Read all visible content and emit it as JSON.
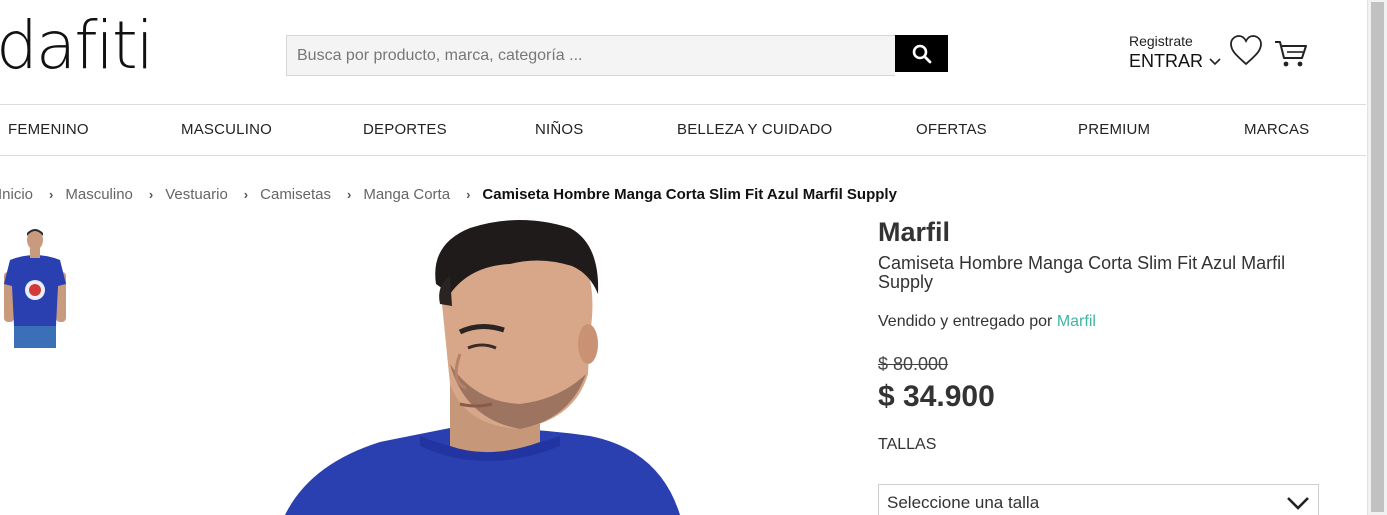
{
  "header": {
    "logo": "dafiti",
    "search_placeholder": "Busca por producto, marca, categoría ...",
    "register_label": "Registrate",
    "login_label": "ENTRAR"
  },
  "nav": {
    "items": [
      "FEMENINO",
      "MASCULINO",
      "DEPORTES",
      "NIÑOS",
      "BELLEZA Y CUIDADO",
      "OFERTAS",
      "PREMIUM",
      "MARCAS"
    ]
  },
  "breadcrumb": {
    "items": [
      "Inicio",
      "Masculino",
      "Vestuario",
      "Camisetas",
      "Manga Corta"
    ],
    "current": "Camiseta Hombre Manga Corta Slim Fit Azul Marfil Supply"
  },
  "product": {
    "brand": "Marfil",
    "name": "Camiseta Hombre Manga Corta Slim Fit Azul Marfil Supply",
    "seller_prefix": "Vendido y entregado por",
    "seller_name": "Marfil",
    "old_price": "$ 80.000",
    "price": "$ 34.900",
    "sizes_label": "TALLAS",
    "size_placeholder": "Seleccione una talla"
  },
  "colors": {
    "accent_link": "#3eb6a4",
    "shirt_blue": "#2a3fb0",
    "button_black": "#000000"
  },
  "icons": [
    "search-icon",
    "chevron-down-icon",
    "heart-icon",
    "cart-icon"
  ]
}
